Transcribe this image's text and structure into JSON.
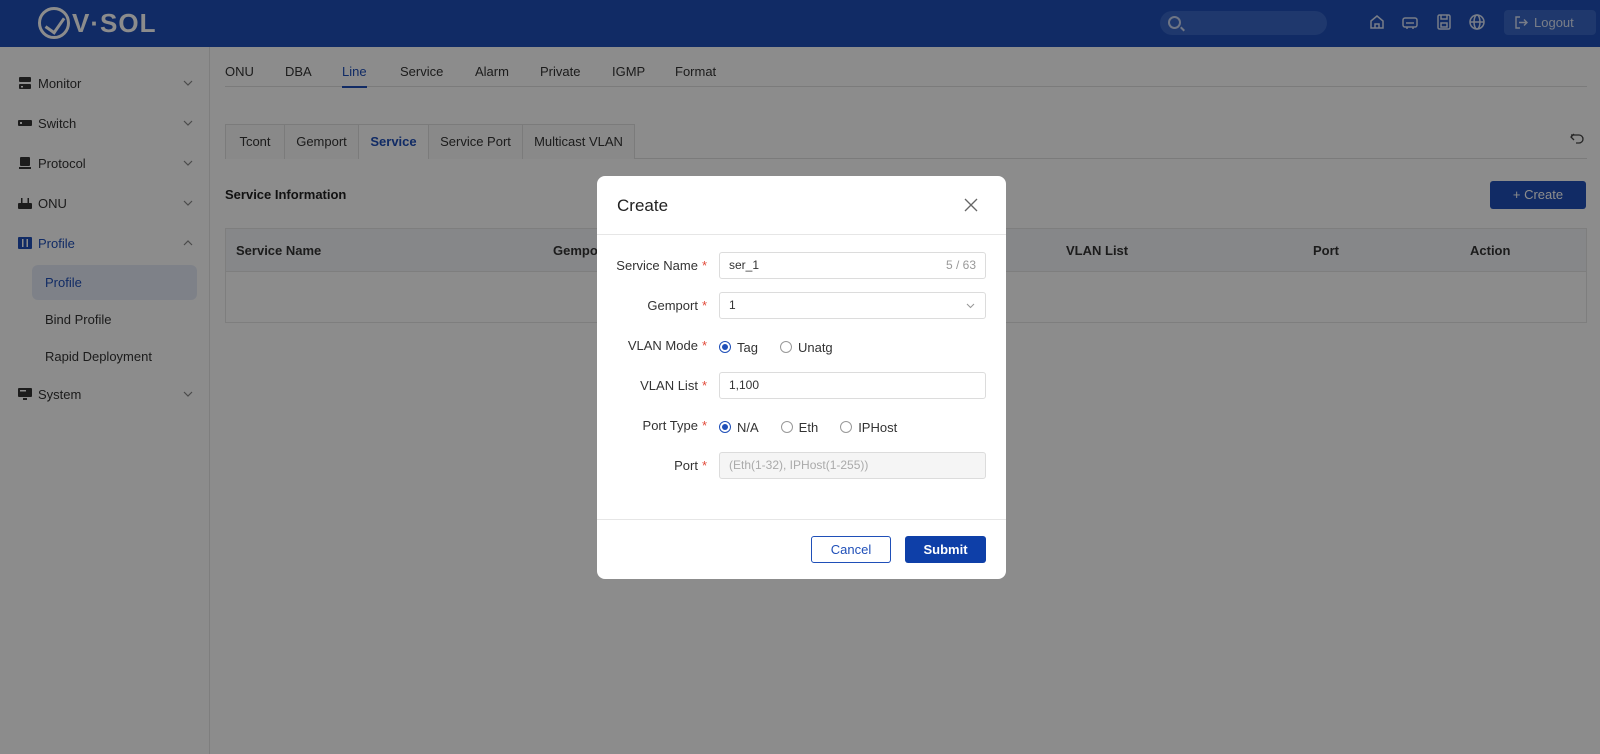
{
  "header": {
    "logo_text": "V·SOL",
    "logout_label": "Logout"
  },
  "sidebar": {
    "items": [
      {
        "label": "Monitor",
        "icon": "monitor-icon"
      },
      {
        "label": "Switch",
        "icon": "switch-icon"
      },
      {
        "label": "Protocol",
        "icon": "protocol-icon"
      },
      {
        "label": "ONU",
        "icon": "onu-icon"
      },
      {
        "label": "Profile",
        "icon": "profile-icon"
      },
      {
        "label": "System",
        "icon": "system-icon"
      }
    ],
    "profile_children": [
      "Profile",
      "Bind Profile",
      "Rapid Deployment"
    ]
  },
  "top_tabs": [
    "ONU",
    "DBA",
    "Line",
    "Service",
    "Alarm",
    "Private",
    "IGMP",
    "Format"
  ],
  "active_top_tab": "Line",
  "sub_tabs": [
    "Tcont",
    "Gemport",
    "Service",
    "Service Port",
    "Multicast VLAN"
  ],
  "active_sub_tab": "Service",
  "section_title": "Service Information",
  "create_button": "+ Create",
  "table": {
    "columns": [
      "Service Name",
      "Gemport",
      "VLAN List",
      "Port",
      "Action"
    ]
  },
  "modal": {
    "title": "Create",
    "fields": {
      "service_name": {
        "label": "Service Name",
        "value": "ser_1",
        "counter": "5 / 63"
      },
      "gemport": {
        "label": "Gemport",
        "value": "1"
      },
      "vlan_mode": {
        "label": "VLAN Mode",
        "options": [
          "Tag",
          "Unatg"
        ],
        "selected": "Tag"
      },
      "vlan_list": {
        "label": "VLAN List",
        "value": "1,100"
      },
      "port_type": {
        "label": "Port Type",
        "options": [
          "N/A",
          "Eth",
          "IPHost"
        ],
        "selected": "N/A"
      },
      "port": {
        "label": "Port",
        "placeholder": "(Eth(1-32), IPHost(1-255))"
      }
    },
    "required_mark": "*",
    "cancel_label": "Cancel",
    "submit_label": "Submit"
  },
  "colors": {
    "brand": "#1f4fb8",
    "required": "#e24b3b"
  }
}
